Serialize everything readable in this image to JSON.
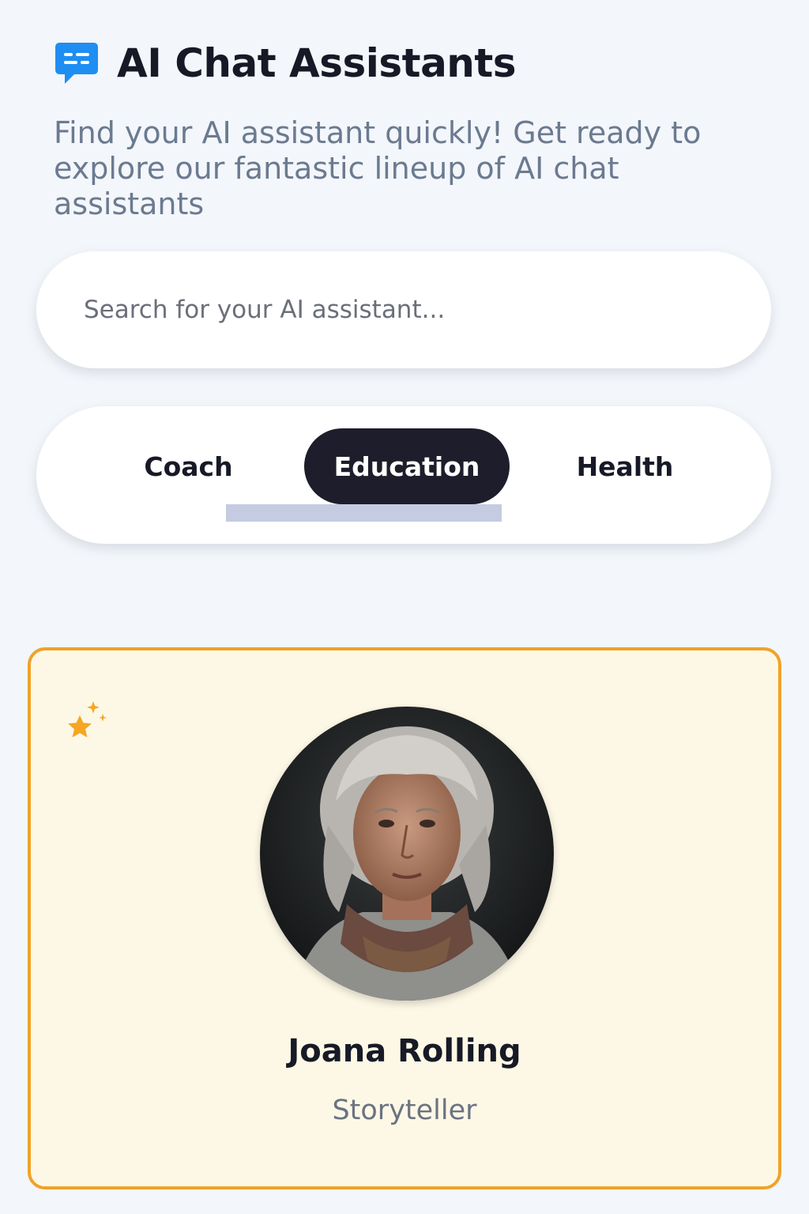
{
  "header": {
    "title": "AI Chat Assistants",
    "subtitle": "Find your AI assistant quickly! Get ready to explore our fantastic lineup of AI chat assistants",
    "icon": "chat-bubble-icon"
  },
  "search": {
    "placeholder": "Search for your AI assistant...",
    "value": ""
  },
  "tabs": {
    "items": [
      {
        "label": "Coach",
        "active": false
      },
      {
        "label": "Education",
        "active": true
      },
      {
        "label": "Health",
        "active": false
      }
    ]
  },
  "card": {
    "name": "Joana Rolling",
    "role": "Storyteller",
    "badge_icon": "sparkle-star-icon",
    "avatar": "portrait of an elderly woman with gray curly hair"
  },
  "colors": {
    "background": "#f3f6fa",
    "accent_blue": "#1e8ef2",
    "active_tab": "#1d1d2b",
    "card_border": "#f0a22a",
    "card_background": "#fdf8e6",
    "star": "#f5a623"
  }
}
